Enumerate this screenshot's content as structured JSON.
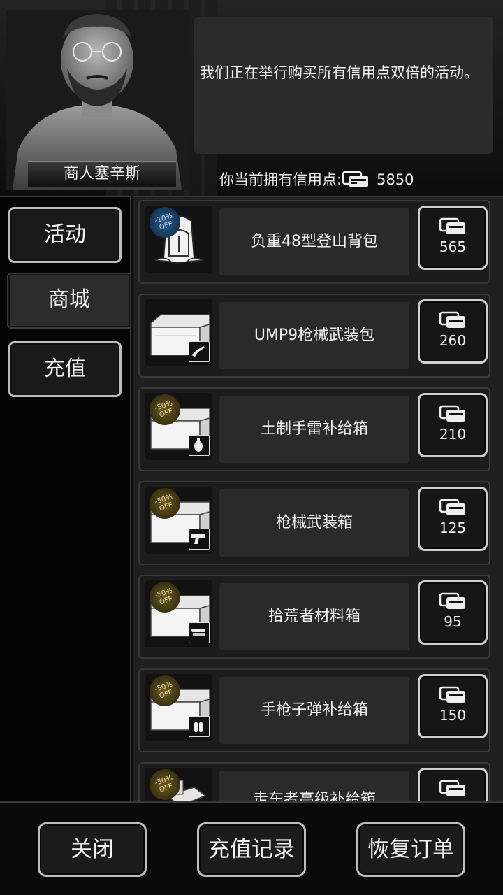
{
  "merchant": {
    "name": "商人塞辛斯"
  },
  "dialog": {
    "message": "我们正在举行购买所有信用点双倍的活动。"
  },
  "credits": {
    "label": "你当前拥有信用点:",
    "value": "5850"
  },
  "sidebar": {
    "tabs": [
      {
        "label": "活动"
      },
      {
        "label": "商城"
      },
      {
        "label": "充值"
      }
    ],
    "active": "商城"
  },
  "items": [
    {
      "name": "负重48型登山背包",
      "price": "565",
      "badge_top": "-10%",
      "badge_bottom": "OFF"
    },
    {
      "name": "UMP9枪械武装包",
      "price": "260"
    },
    {
      "name": "土制手雷补给箱",
      "price": "210",
      "badge_top": "-50%",
      "badge_bottom": "OFF"
    },
    {
      "name": "枪械武装箱",
      "price": "125",
      "badge_top": "-50%",
      "badge_bottom": "OFF"
    },
    {
      "name": "拾荒者材料箱",
      "price": "95",
      "badge_top": "-50%",
      "badge_bottom": "OFF"
    },
    {
      "name": "手枪子弹补给箱",
      "price": "150",
      "badge_top": "-50%",
      "badge_bottom": "OFF"
    },
    {
      "name": "走车者高级补给箱",
      "price": "",
      "badge_top": "-50%",
      "badge_bottom": "OFF"
    }
  ],
  "footer": {
    "close": "关闭",
    "history": "充值记录",
    "restore": "恢复订单"
  },
  "colors": {
    "background": "#0c0c0c",
    "panel": "#1f1f1f",
    "button_border": "#cfcfcf",
    "badge_gold": "#6b5a20",
    "badge_blue": "#2a5a8a"
  },
  "icons": {
    "credit": "credit-card-icon",
    "backpack": "backpack-icon",
    "crate": "crate-icon",
    "rifle": "rifle-icon",
    "grenade": "grenade-icon",
    "pistol": "pistol-icon",
    "materials": "materials-icon",
    "ammo": "ammo-icon"
  }
}
